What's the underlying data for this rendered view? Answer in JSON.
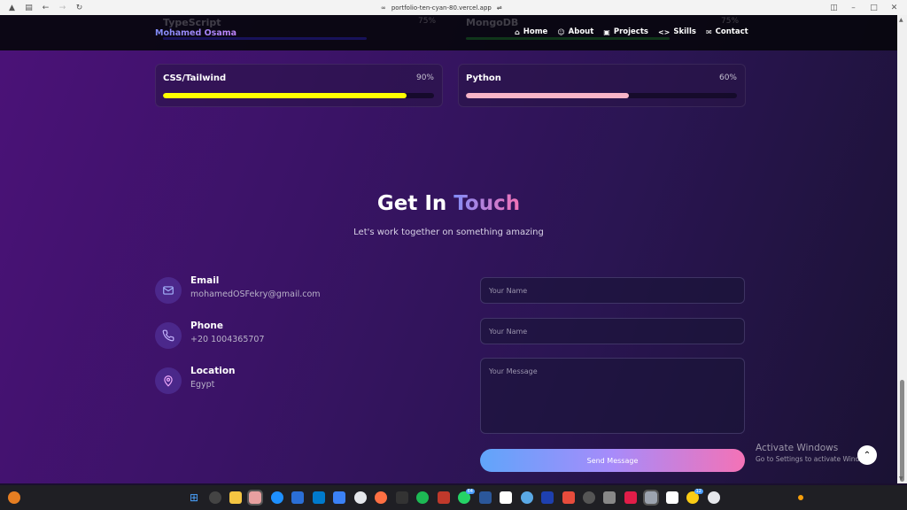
{
  "browser": {
    "url": "portfolio-ten-cyan-80.vercel.app"
  },
  "nav": {
    "brand": "Mohamed Osama",
    "links": [
      {
        "label": "Home",
        "icon": "home-icon"
      },
      {
        "label": "About",
        "icon": "user-icon"
      },
      {
        "label": "Projects",
        "icon": "briefcase-icon"
      },
      {
        "label": "Skills",
        "icon": "code-icon"
      },
      {
        "label": "Contact",
        "icon": "mail-icon"
      }
    ]
  },
  "skills": {
    "partial": [
      {
        "name": "TypeScript",
        "percent": "75%"
      },
      {
        "name": "MongoDB",
        "percent": "75%"
      }
    ],
    "cards": [
      {
        "name": "CSS/Tailwind",
        "percent": "90%",
        "level": 0.9,
        "color": "#ffff00"
      },
      {
        "name": "Python",
        "percent": "60%",
        "level": 0.6,
        "color": "#f8b4c8"
      }
    ]
  },
  "contact": {
    "title_main": "Get In",
    "title_accent": "Touch",
    "subtitle": "Let's work together on something amazing",
    "items": [
      {
        "label": "Email",
        "value": "mohamedOSFekry@gmail.com",
        "icon": "mail-icon"
      },
      {
        "label": "Phone",
        "value": "+20 1004365707",
        "icon": "phone-icon"
      },
      {
        "label": "Location",
        "value": "Egypt",
        "icon": "map-pin-icon"
      }
    ],
    "form": {
      "name_placeholder": "Your Name",
      "second_placeholder": "Your Name",
      "message_placeholder": "Your Message",
      "send_label": "Send Message"
    }
  },
  "watermark": {
    "line1": "Activate Windows",
    "line2": "Go to Settings to activate Windows."
  },
  "taskbar": {
    "badges": [
      "64",
      "12"
    ]
  },
  "colors": {
    "accent_purple": "#a78bfa",
    "accent_pink": "#f472b6",
    "accent_blue": "#60a5fa"
  }
}
